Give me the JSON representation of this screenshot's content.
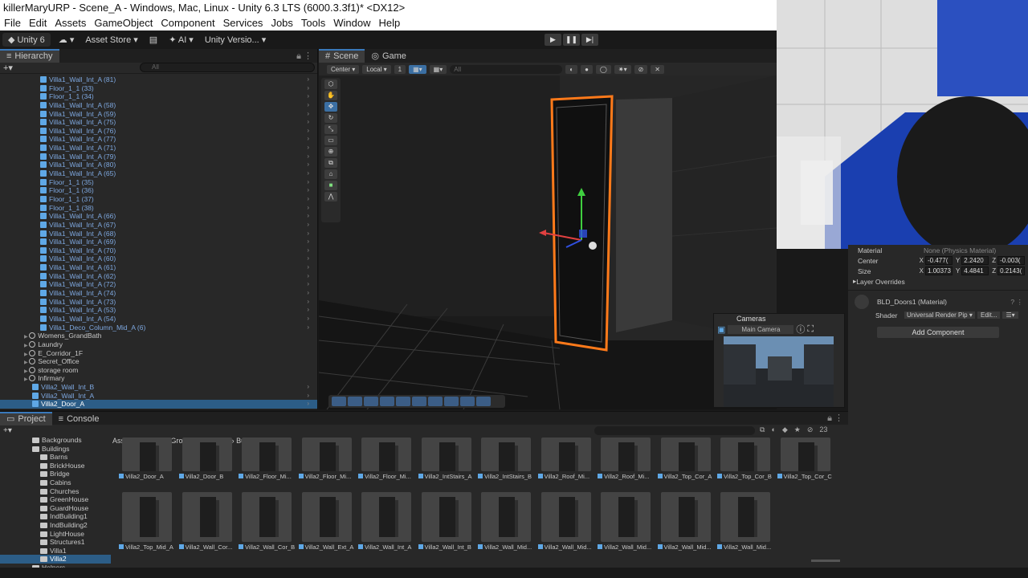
{
  "window": {
    "title": "killerMaryURP - Scene_A - Windows, Mac, Linux - Unity 6.3 LTS (6000.3.3f1)* <DX12>"
  },
  "menu": [
    "File",
    "Edit",
    "Assets",
    "GameObject",
    "Component",
    "Services",
    "Jobs",
    "Tools",
    "Window",
    "Help"
  ],
  "toolbar": {
    "account": "Unity 6",
    "cloud": "☁ ▾",
    "asset_store": "Asset Store ▾",
    "ai": "✦ AI ▾",
    "version_control": "Unity Versio... ▾"
  },
  "hierarchy": {
    "tab": "Hierarchy",
    "search_placeholder": "All",
    "rows": [
      {
        "label": "Villa1_Wall_Int_A (81)",
        "kind": "prefab",
        "indent": 50
      },
      {
        "label": "Floor_1_1 (33)",
        "kind": "prefab",
        "indent": 50
      },
      {
        "label": "Floor_1_1 (34)",
        "kind": "prefab",
        "indent": 50
      },
      {
        "label": "Villa1_Wall_Int_A (58)",
        "kind": "prefab",
        "indent": 50
      },
      {
        "label": "Villa1_Wall_Int_A (59)",
        "kind": "prefab",
        "indent": 50
      },
      {
        "label": "Villa1_Wall_Int_A (75)",
        "kind": "prefab",
        "indent": 50
      },
      {
        "label": "Villa1_Wall_Int_A (76)",
        "kind": "prefab",
        "indent": 50
      },
      {
        "label": "Villa1_Wall_Int_A (77)",
        "kind": "prefab",
        "indent": 50
      },
      {
        "label": "Villa1_Wall_Int_A (71)",
        "kind": "prefab",
        "indent": 50
      },
      {
        "label": "Villa1_Wall_Int_A (79)",
        "kind": "prefab",
        "indent": 50
      },
      {
        "label": "Villa1_Wall_Int_A (80)",
        "kind": "prefab",
        "indent": 50
      },
      {
        "label": "Villa1_Wall_Int_A (65)",
        "kind": "prefab",
        "indent": 50
      },
      {
        "label": "Floor_1_1 (35)",
        "kind": "prefab",
        "indent": 50
      },
      {
        "label": "Floor_1_1 (36)",
        "kind": "prefab",
        "indent": 50
      },
      {
        "label": "Floor_1_1 (37)",
        "kind": "prefab",
        "indent": 50
      },
      {
        "label": "Floor_1_1 (38)",
        "kind": "prefab",
        "indent": 50
      },
      {
        "label": "Villa1_Wall_Int_A (66)",
        "kind": "prefab",
        "indent": 50
      },
      {
        "label": "Villa1_Wall_Int_A (67)",
        "kind": "prefab",
        "indent": 50
      },
      {
        "label": "Villa1_Wall_Int_A (68)",
        "kind": "prefab",
        "indent": 50
      },
      {
        "label": "Villa1_Wall_Int_A (69)",
        "kind": "prefab",
        "indent": 50
      },
      {
        "label": "Villa1_Wall_Int_A (70)",
        "kind": "prefab",
        "indent": 50
      },
      {
        "label": "Villa1_Wall_Int_A (60)",
        "kind": "prefab",
        "indent": 50
      },
      {
        "label": "Villa1_Wall_Int_A (61)",
        "kind": "prefab",
        "indent": 50
      },
      {
        "label": "Villa1_Wall_Int_A (62)",
        "kind": "prefab",
        "indent": 50
      },
      {
        "label": "Villa1_Wall_Int_A (72)",
        "kind": "prefab",
        "indent": 50
      },
      {
        "label": "Villa1_Wall_Int_A (74)",
        "kind": "prefab",
        "indent": 50
      },
      {
        "label": "Villa1_Wall_Int_A (73)",
        "kind": "prefab",
        "indent": 50
      },
      {
        "label": "Villa1_Wall_Int_A (53)",
        "kind": "prefab",
        "indent": 50
      },
      {
        "label": "Villa1_Wall_Int_A (54)",
        "kind": "prefab",
        "indent": 50
      },
      {
        "label": "Villa1_Deco_Column_Mid_A (6)",
        "kind": "prefab",
        "indent": 50
      },
      {
        "label": "Womens_GrandBath",
        "kind": "object",
        "indent": 40,
        "arrow": "▶"
      },
      {
        "label": "Laundry",
        "kind": "object",
        "indent": 40,
        "arrow": "▶"
      },
      {
        "label": "E_Corridor_1F",
        "kind": "object",
        "indent": 40,
        "arrow": "▶"
      },
      {
        "label": "Secret_Office",
        "kind": "object",
        "indent": 40,
        "arrow": "▶"
      },
      {
        "label": "storage room",
        "kind": "object",
        "indent": 40,
        "arrow": "▶"
      },
      {
        "label": "Infirmary",
        "kind": "object",
        "indent": 40,
        "arrow": "▶"
      },
      {
        "label": "Villa2_Wall_Int_B",
        "kind": "prefab",
        "indent": 40
      },
      {
        "label": "Villa2_Wall_Int_A",
        "kind": "prefab",
        "indent": 40
      },
      {
        "label": "Villa2_Door_A",
        "kind": "prefab",
        "indent": 40,
        "selected": true
      }
    ]
  },
  "scene": {
    "tabs": [
      "Scene",
      "Game"
    ],
    "pivot": "Center ▾",
    "space": "Local ▾",
    "snap": "1",
    "search_placeholder": "All"
  },
  "cameras": {
    "title": "Cameras",
    "selected": "Main Camera"
  },
  "inspector": {
    "material_label": "Material",
    "material_value": "None (Physics Material)",
    "center_label": "Center",
    "center": {
      "x": "-0.477(",
      "y": "2.2420",
      "z": "-0.003("
    },
    "size_label": "Size",
    "size": {
      "x": "1.00373",
      "y": "4.4841",
      "z": "0.2143("
    },
    "layer_overrides": "Layer Overrides",
    "mat_name": "BLD_Doors1 (Material)",
    "shader_label": "Shader",
    "shader_value": "Universal Render Pip ▾",
    "edit_label": "Edit...",
    "add_component": "Add Component"
  },
  "project": {
    "tabs": [
      "Project",
      "Console"
    ],
    "tree": [
      {
        "label": "Backgrounds",
        "indent": 40
      },
      {
        "label": "Buildings",
        "indent": 40,
        "arrow": "▼"
      },
      {
        "label": "Barns",
        "indent": 50
      },
      {
        "label": "BrickHouse",
        "indent": 50
      },
      {
        "label": "Bridge",
        "indent": 50
      },
      {
        "label": "Cabins",
        "indent": 50
      },
      {
        "label": "Churches",
        "indent": 50
      },
      {
        "label": "GreenHouse",
        "indent": 50
      },
      {
        "label": "GuardHouse",
        "indent": 50
      },
      {
        "label": "IndBuilding1",
        "indent": 50
      },
      {
        "label": "IndBuilding2",
        "indent": 50
      },
      {
        "label": "LightHouse",
        "indent": 50
      },
      {
        "label": "Structures1",
        "indent": 50
      },
      {
        "label": "Villa1",
        "indent": 50
      },
      {
        "label": "Villa2",
        "indent": 50,
        "selected": true
      },
      {
        "label": "Helpers",
        "indent": 40
      }
    ],
    "breadcrumb": [
      "Assets",
      "Flooded_Grounds",
      "Prefabs",
      "Buildings",
      "Villa2"
    ],
    "count": "23",
    "assets_row1": [
      "Villa2_Door_A",
      "Villa2_Door_B",
      "Villa2_Floor_Mi...",
      "Villa2_Floor_Mi...",
      "Villa2_Floor_Mi...",
      "Villa2_IntStairs_A",
      "Villa2_IntStairs_B",
      "Villa2_Roof_Mi...",
      "Villa2_Roof_Mi...",
      "Villa2_Top_Cor_A",
      "Villa2_Top_Cor_B",
      "Villa2_Top_Cor_C"
    ],
    "assets_row2": [
      "Villa2_Top_Mid_A",
      "Villa2_Wall_Cor...",
      "Villa2_Wall_Cor_B",
      "Villa2_Wall_Ext_A",
      "Villa2_Wall_Int_A",
      "Villa2_Wall_Int_B",
      "Villa2_Wall_Mid...",
      "Villa2_Wall_Mid...",
      "Villa2_Wall_Mid...",
      "Villa2_Wall_Mid...",
      "Villa2_Wall_Mid..."
    ]
  }
}
